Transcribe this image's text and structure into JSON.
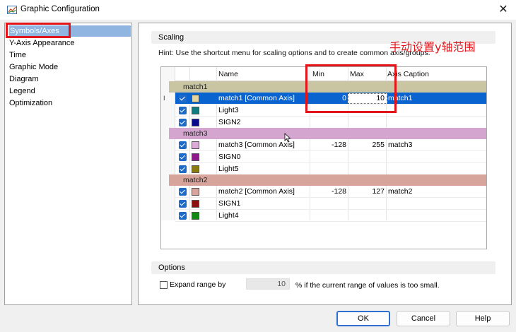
{
  "window": {
    "title": "Graphic Configuration",
    "close_glyph": "✕"
  },
  "nav": {
    "items": [
      {
        "label": "Symbols/Axes",
        "selected": true
      },
      {
        "label": "Y-Axis Appearance"
      },
      {
        "label": "Time"
      },
      {
        "label": "Graphic Mode"
      },
      {
        "label": "Diagram"
      },
      {
        "label": "Legend"
      },
      {
        "label": "Optimization"
      }
    ]
  },
  "scaling": {
    "header": "Scaling",
    "hint": "Hint: Use the shortcut menu for scaling options and to create common axis/groups.",
    "annotation": "手动设置y轴范围",
    "columns": {
      "name": "Name",
      "min": "Min",
      "max": "Max",
      "caption": "Axis Caption"
    },
    "groups": [
      {
        "label": "match1",
        "color": "#c9c5a3",
        "rows": [
          {
            "name": "match1 [Common Axis]",
            "min": "0",
            "max": "10",
            "caption": "match1",
            "swatch": "#e3d6a1",
            "selected": true,
            "marker": "I"
          },
          {
            "name": "Light3",
            "min": "",
            "max": "",
            "caption": "",
            "swatch": "#117d80"
          },
          {
            "name": "SIGN2",
            "min": "",
            "max": "",
            "caption": "",
            "swatch": "#0a0a8c"
          }
        ]
      },
      {
        "label": "match3",
        "color": "#d4a6cf",
        "rows": [
          {
            "name": "match3 [Common Axis]",
            "min": "-128",
            "max": "255",
            "caption": "match3",
            "swatch": "#dcaad6"
          },
          {
            "name": "SIGN0",
            "min": "",
            "max": "",
            "caption": "",
            "swatch": "#8e1a8e"
          },
          {
            "name": "Light5",
            "min": "",
            "max": "",
            "caption": "",
            "swatch": "#8a7a10"
          }
        ]
      },
      {
        "label": "match2",
        "color": "#d7a49c",
        "rows": [
          {
            "name": "match2 [Common Axis]",
            "min": "-128",
            "max": "127",
            "caption": "match2",
            "swatch": "#d8a39c"
          },
          {
            "name": "SIGN1",
            "min": "",
            "max": "",
            "caption": "",
            "swatch": "#8c1010"
          },
          {
            "name": "Light4",
            "min": "",
            "max": "",
            "caption": "",
            "swatch": "#108a10"
          }
        ]
      }
    ]
  },
  "options": {
    "header": "Options",
    "expand_label": "Expand range by",
    "expand_checked": false,
    "range_value": "10",
    "suffix": "%  if the current range of values is too small."
  },
  "buttons": {
    "ok": "OK",
    "cancel": "Cancel",
    "help": "Help"
  },
  "colors": {
    "selection": "#0a64d0",
    "annotation_red": "#e3151a",
    "nav_selected": "#8fb5e0"
  }
}
